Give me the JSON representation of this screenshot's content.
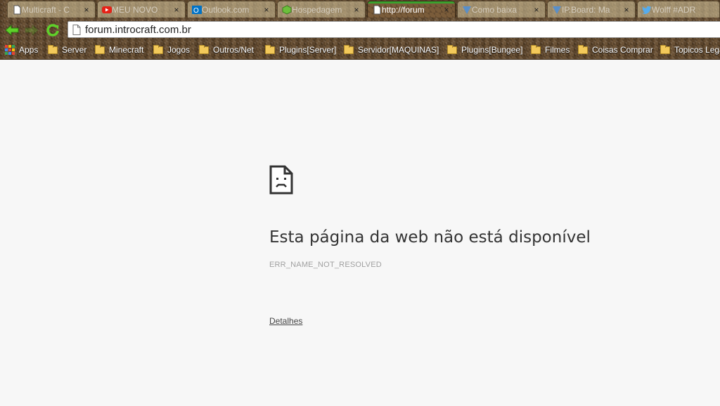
{
  "tabs": [
    {
      "label": "Multicraft - C",
      "favicon": "page-icon",
      "active": false
    },
    {
      "label": "MEU NOVO",
      "favicon": "youtube-icon",
      "active": false
    },
    {
      "label": "Outlook.com",
      "favicon": "outlook-icon",
      "active": false
    },
    {
      "label": "Hospedagem",
      "favicon": "green-cube-icon",
      "active": false
    },
    {
      "label": "http://forum",
      "favicon": "page-icon",
      "active": true
    },
    {
      "label": "Como baixa",
      "favicon": "ipboard-icon",
      "active": false
    },
    {
      "label": "IP.Board: Ma",
      "favicon": "ipboard-icon",
      "active": false
    },
    {
      "label": "Wolff #ADR",
      "favicon": "twitter-icon",
      "active": false
    }
  ],
  "tab_close_glyph": "×",
  "toolbar": {
    "url": "forum.introcraft.com.br"
  },
  "bookmarks": {
    "apps_label": "Apps",
    "folders": [
      "Server",
      "Minecraft",
      "Jogos",
      "Outros/Net",
      "Plugins[Server]",
      "Servidor[MAQUINAS]",
      "Plugins[Bungee]",
      "Filmes",
      "Coisas Comprar",
      "Topicos Lega"
    ]
  },
  "error": {
    "title": "Esta página da web não está disponível",
    "code": "ERR_NAME_NOT_RESOLVED",
    "details_link": "Detalhes"
  },
  "colors": {
    "theme_dirt": "#6b5236",
    "page_background": "#f7f7f7",
    "youtube_red": "#e62117",
    "outlook_blue": "#0072c6",
    "twitter_blue": "#55acee",
    "arrow_green": "#5fd12a"
  }
}
